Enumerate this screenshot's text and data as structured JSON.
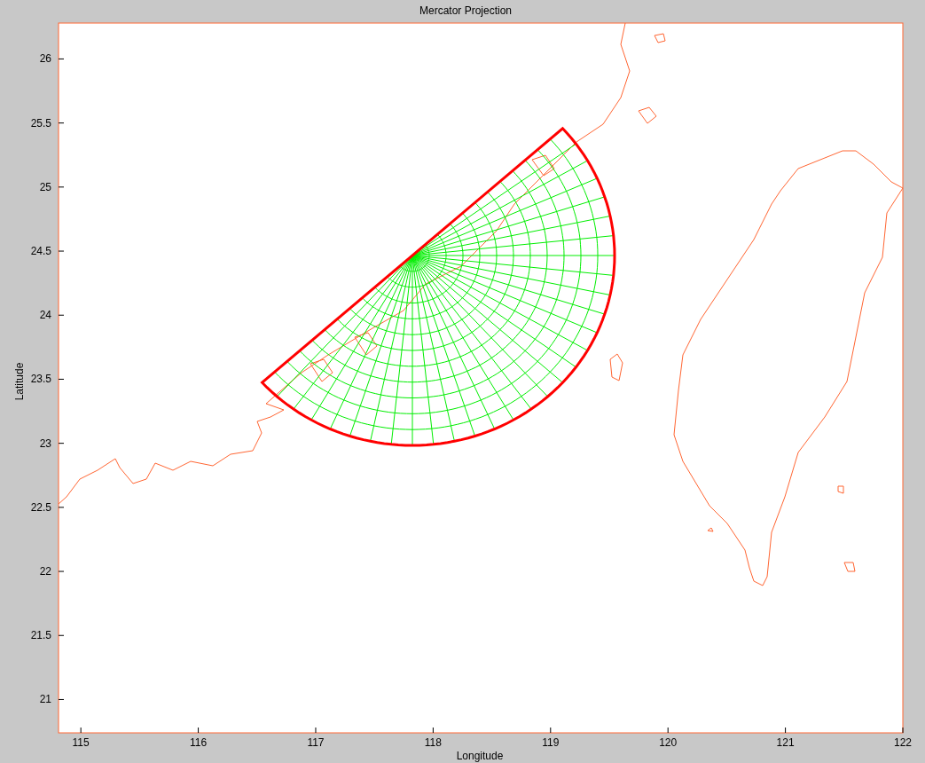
{
  "chart_data": {
    "type": "line",
    "title": "Mercator Projection",
    "xlabel": "Longitude",
    "ylabel": "Latitude",
    "xlim": [
      114.81,
      122
    ],
    "ylim": [
      20.74,
      26.28
    ],
    "xticks": [
      115,
      116,
      117,
      118,
      119,
      120,
      121,
      122
    ],
    "yticks": [
      21,
      21.5,
      22,
      22.5,
      23,
      23.5,
      24,
      24.5,
      25,
      25.5,
      26
    ]
  }
}
